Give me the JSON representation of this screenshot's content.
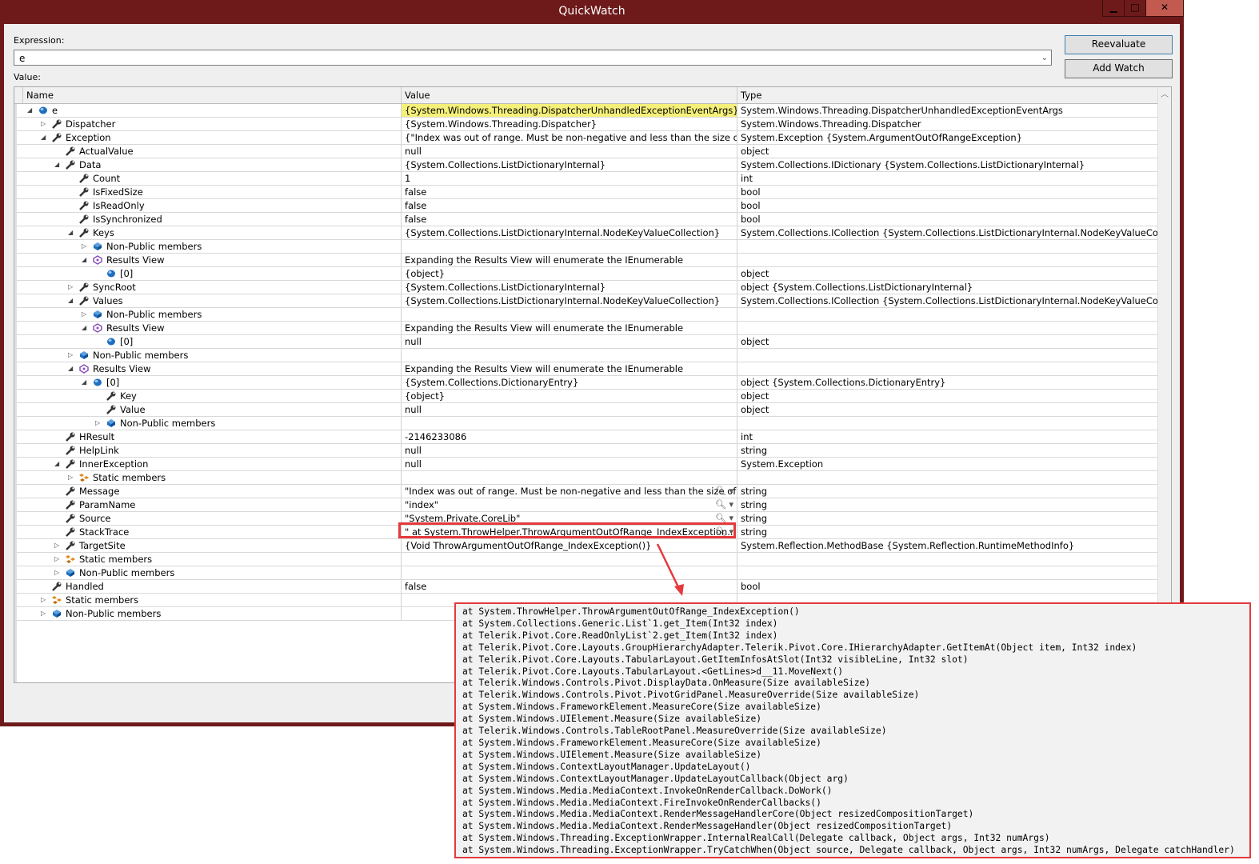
{
  "window": {
    "title": "QuickWatch",
    "minimize": "▁",
    "maximize": "□",
    "close": "✕"
  },
  "expression": {
    "label": "Expression:",
    "value": "e"
  },
  "value_label": "Value:",
  "buttons": {
    "reevaluate": "Reevaluate",
    "add_watch": "Add Watch"
  },
  "columns": {
    "name": "Name",
    "value": "Value",
    "type": "Type"
  },
  "colors": {
    "title_bar": "#6e1a1a",
    "highlight": "#f5f07a",
    "callout": "#e5393b"
  },
  "rows": [
    {
      "name": "e",
      "level": 0,
      "exp": "open",
      "icon": "object",
      "value": "{System.Windows.Threading.DispatcherUnhandledExceptionEventArgs}",
      "type": "System.Windows.Threading.DispatcherUnhandledExceptionEventArgs",
      "highlight": true
    },
    {
      "name": "Dispatcher",
      "level": 1,
      "exp": "closed",
      "icon": "property",
      "value": "{System.Windows.Threading.Dispatcher}",
      "type": "System.Windows.Threading.Dispatcher"
    },
    {
      "name": "Exception",
      "level": 1,
      "exp": "open",
      "icon": "property",
      "value": "{\"Index was out of range. Must be non-negative and less than the size of the ...",
      "type": "System.Exception {System.ArgumentOutOfRangeException}"
    },
    {
      "name": "ActualValue",
      "level": 2,
      "exp": "none",
      "icon": "property",
      "value": "null",
      "type": "object"
    },
    {
      "name": "Data",
      "level": 2,
      "exp": "open",
      "icon": "property",
      "value": "{System.Collections.ListDictionaryInternal}",
      "type": "System.Collections.IDictionary {System.Collections.ListDictionaryInternal}"
    },
    {
      "name": "Count",
      "level": 3,
      "exp": "none",
      "icon": "property",
      "value": "1",
      "type": "int"
    },
    {
      "name": "IsFixedSize",
      "level": 3,
      "exp": "none",
      "icon": "property",
      "value": "false",
      "type": "bool"
    },
    {
      "name": "IsReadOnly",
      "level": 3,
      "exp": "none",
      "icon": "property",
      "value": "false",
      "type": "bool"
    },
    {
      "name": "IsSynchronized",
      "level": 3,
      "exp": "none",
      "icon": "property",
      "value": "false",
      "type": "bool"
    },
    {
      "name": "Keys",
      "level": 3,
      "exp": "open",
      "icon": "property",
      "value": "{System.Collections.ListDictionaryInternal.NodeKeyValueCollection}",
      "type": "System.Collections.ICollection {System.Collections.ListDictionaryInternal.NodeKeyValueCollection}"
    },
    {
      "name": "Non-Public members",
      "level": 4,
      "exp": "closed",
      "icon": "nonpublic",
      "value": "",
      "type": ""
    },
    {
      "name": "Results View",
      "level": 4,
      "exp": "open",
      "icon": "results",
      "value": "Expanding the Results View will enumerate the IEnumerable",
      "type": ""
    },
    {
      "name": "[0]",
      "level": 5,
      "exp": "none",
      "icon": "object",
      "value": "{object}",
      "type": "object"
    },
    {
      "name": "SyncRoot",
      "level": 3,
      "exp": "closed",
      "icon": "property",
      "value": "{System.Collections.ListDictionaryInternal}",
      "type": "object {System.Collections.ListDictionaryInternal}"
    },
    {
      "name": "Values",
      "level": 3,
      "exp": "open",
      "icon": "property",
      "value": "{System.Collections.ListDictionaryInternal.NodeKeyValueCollection}",
      "type": "System.Collections.ICollection {System.Collections.ListDictionaryInternal.NodeKeyValueCollection}"
    },
    {
      "name": "Non-Public members",
      "level": 4,
      "exp": "closed",
      "icon": "nonpublic",
      "value": "",
      "type": ""
    },
    {
      "name": "Results View",
      "level": 4,
      "exp": "open",
      "icon": "results",
      "value": "Expanding the Results View will enumerate the IEnumerable",
      "type": ""
    },
    {
      "name": "[0]",
      "level": 5,
      "exp": "none",
      "icon": "object",
      "value": "null",
      "type": "object"
    },
    {
      "name": "Non-Public members",
      "level": 3,
      "exp": "closed",
      "icon": "nonpublic",
      "value": "",
      "type": ""
    },
    {
      "name": "Results View",
      "level": 3,
      "exp": "open",
      "icon": "results",
      "value": "Expanding the Results View will enumerate the IEnumerable",
      "type": ""
    },
    {
      "name": "[0]",
      "level": 4,
      "exp": "open",
      "icon": "object",
      "value": "{System.Collections.DictionaryEntry}",
      "type": "object {System.Collections.DictionaryEntry}"
    },
    {
      "name": "Key",
      "level": 5,
      "exp": "none",
      "icon": "property",
      "value": "{object}",
      "type": "object"
    },
    {
      "name": "Value",
      "level": 5,
      "exp": "none",
      "icon": "property",
      "value": "null",
      "type": "object"
    },
    {
      "name": "Non-Public members",
      "level": 5,
      "exp": "closed",
      "icon": "nonpublic",
      "value": "",
      "type": ""
    },
    {
      "name": "HResult",
      "level": 2,
      "exp": "none",
      "icon": "property",
      "value": "-2146233086",
      "type": "int"
    },
    {
      "name": "HelpLink",
      "level": 2,
      "exp": "none",
      "icon": "property",
      "value": "null",
      "type": "string"
    },
    {
      "name": "InnerException",
      "level": 2,
      "exp": "open",
      "icon": "property",
      "value": "null",
      "type": "System.Exception"
    },
    {
      "name": "Static members",
      "level": 3,
      "exp": "closed",
      "icon": "static",
      "value": "",
      "type": ""
    },
    {
      "name": "Message",
      "level": 2,
      "exp": "none",
      "icon": "property",
      "value": "\"Index was out of range. Must be non-negative and less than the size of ...",
      "type": "string",
      "tools": true
    },
    {
      "name": "ParamName",
      "level": 2,
      "exp": "none",
      "icon": "property",
      "value": "\"index\"",
      "type": "string",
      "tools": true
    },
    {
      "name": "Source",
      "level": 2,
      "exp": "none",
      "icon": "property",
      "value": "\"System.Private.CoreLib\"",
      "type": "string",
      "tools": true
    },
    {
      "name": "StackTrace",
      "level": 2,
      "exp": "none",
      "icon": "property",
      "value": "\"   at System.ThrowHelper.ThrowArgumentOutOfRange_IndexException...",
      "type": "string",
      "tools": true
    },
    {
      "name": "TargetSite",
      "level": 2,
      "exp": "closed",
      "icon": "property",
      "value": "{Void ThrowArgumentOutOfRange_IndexException()}",
      "type": "System.Reflection.MethodBase {System.Reflection.RuntimeMethodInfo}"
    },
    {
      "name": "Static members",
      "level": 2,
      "exp": "closed",
      "icon": "static",
      "value": "",
      "type": ""
    },
    {
      "name": "Non-Public members",
      "level": 2,
      "exp": "closed",
      "icon": "nonpublic",
      "value": "",
      "type": ""
    },
    {
      "name": "Handled",
      "level": 1,
      "exp": "none",
      "icon": "property",
      "value": "false",
      "type": "bool"
    },
    {
      "name": "Static members",
      "level": 1,
      "exp": "closed",
      "icon": "static",
      "value": "",
      "type": ""
    },
    {
      "name": "Non-Public members",
      "level": 1,
      "exp": "closed",
      "icon": "nonpublic",
      "value": "",
      "type": ""
    }
  ],
  "stacktrace_popup": [
    "at System.ThrowHelper.ThrowArgumentOutOfRange_IndexException()",
    "at System.Collections.Generic.List`1.get_Item(Int32 index)",
    "at Telerik.Pivot.Core.ReadOnlyList`2.get_Item(Int32 index)",
    "at Telerik.Pivot.Core.Layouts.GroupHierarchyAdapter.Telerik.Pivot.Core.IHierarchyAdapter.GetItemAt(Object item, Int32 index)",
    "at Telerik.Pivot.Core.Layouts.TabularLayout.GetItemInfosAtSlot(Int32 visibleLine, Int32 slot)",
    "at Telerik.Pivot.Core.Layouts.TabularLayout.<GetLines>d__11.MoveNext()",
    "at Telerik.Windows.Controls.Pivot.DisplayData.OnMeasure(Size availableSize)",
    "at Telerik.Windows.Controls.Pivot.PivotGridPanel.MeasureOverride(Size availableSize)",
    "at System.Windows.FrameworkElement.MeasureCore(Size availableSize)",
    "at System.Windows.UIElement.Measure(Size availableSize)",
    "at Telerik.Windows.Controls.TableRootPanel.MeasureOverride(Size availableSize)",
    "at System.Windows.FrameworkElement.MeasureCore(Size availableSize)",
    "at System.Windows.UIElement.Measure(Size availableSize)",
    "at System.Windows.ContextLayoutManager.UpdateLayout()",
    "at System.Windows.ContextLayoutManager.UpdateLayoutCallback(Object arg)",
    "at System.Windows.Media.MediaContext.InvokeOnRenderCallback.DoWork()",
    "at System.Windows.Media.MediaContext.FireInvokeOnRenderCallbacks()",
    "at System.Windows.Media.MediaContext.RenderMessageHandlerCore(Object resizedCompositionTarget)",
    "at System.Windows.Media.MediaContext.RenderMessageHandler(Object resizedCompositionTarget)",
    "at System.Windows.Threading.ExceptionWrapper.InternalRealCall(Delegate callback, Object args, Int32 numArgs)",
    "at System.Windows.Threading.ExceptionWrapper.TryCatchWhen(Object source, Delegate callback, Object args, Int32 numArgs, Delegate catchHandler)"
  ]
}
